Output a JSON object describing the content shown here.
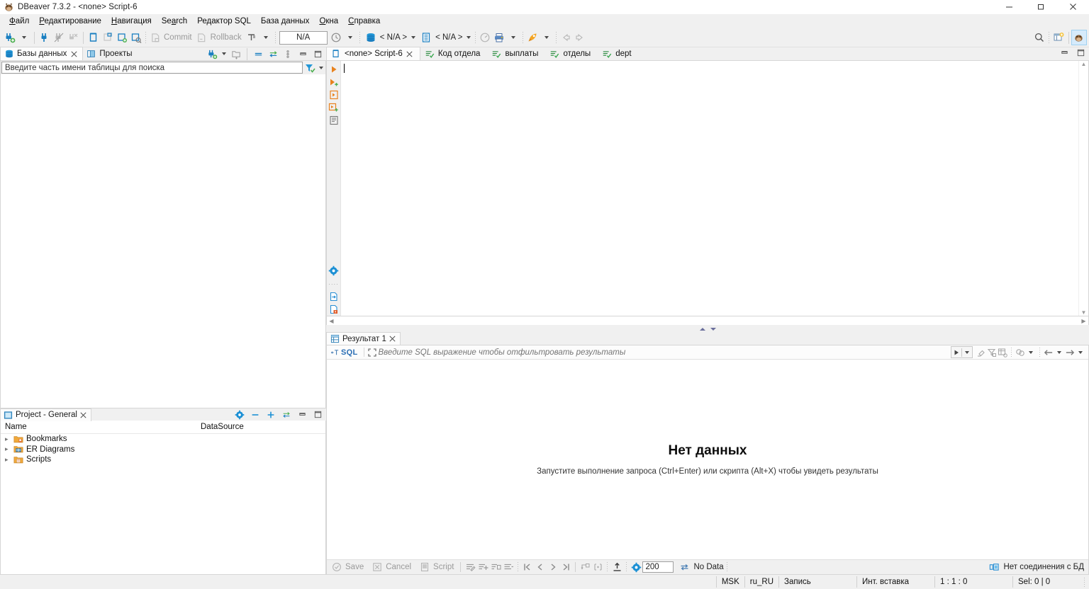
{
  "window": {
    "title": "DBeaver 7.3.2 - <none> Script-6",
    "app_icon": "beaver-icon",
    "minimize": "—",
    "maximize": "❐",
    "close": "✕"
  },
  "menubar": {
    "items": [
      {
        "label": "Файл",
        "mnemonic": "Ф"
      },
      {
        "label": "Редактирование",
        "mnemonic": "Р"
      },
      {
        "label": "Навигация",
        "mnemonic": "Н"
      },
      {
        "label": "Search",
        "mnemonic": "a"
      },
      {
        "label": "Редактор SQL",
        "mnemonic": ""
      },
      {
        "label": "База данных",
        "mnemonic": ""
      },
      {
        "label": "Окна",
        "mnemonic": "О"
      },
      {
        "label": "Справка",
        "mnemonic": "С"
      }
    ]
  },
  "toolbar": {
    "new_connection": "new-connection-icon",
    "connect": "connect-icon",
    "disconnect": "disconnect-icon",
    "invalidate": "invalidate-icon",
    "commit_mode": "transaction-mode-icon",
    "commit_label": "Commit",
    "rollback_label": "Rollback",
    "txn_label": "transaction-log-icon",
    "na_value": "N/A",
    "history_icon": "clock-icon",
    "database_selector": "< N/A >",
    "schema_selector": "< N/A >",
    "dashboard_icon": "dashboard-icon",
    "print_icon": "print-icon",
    "run_icon": "rocket-icon",
    "back_icon": "back-arrow-icon",
    "forward_icon": "forward-arrow-icon",
    "search_icon": "search-icon",
    "new_window_icon": "new-window-icon",
    "perspective_icon": "dbeaver-perspective-icon"
  },
  "navigator": {
    "tabs": [
      {
        "label": "Базы данных",
        "icon": "database-icon",
        "active": true,
        "closable": true
      },
      {
        "label": "Проекты",
        "icon": "projects-icon",
        "active": false,
        "closable": false
      }
    ],
    "tools": [
      "new-connection-icon",
      "chevron-down-icon",
      "new-folder-icon",
      "collapse-all-icon",
      "link-editor-icon",
      "view-menu-icon",
      "minimize-icon",
      "maximize-icon"
    ],
    "search_placeholder": "Введите часть имени таблицы для поиска",
    "search_value": "",
    "filter_icon": "filter-icon",
    "tree_items": []
  },
  "project_panel": {
    "title": "Project - General",
    "icon": "project-icon",
    "tools": [
      "gear-icon",
      "minimize-panel-icon",
      "add-icon",
      "link-editor-icon",
      "minimize-icon",
      "maximize-icon"
    ],
    "columns": [
      "Name",
      "DataSource"
    ],
    "rows": [
      {
        "name": "Bookmarks",
        "icon": "bookmarks-folder-icon",
        "datasource": ""
      },
      {
        "name": "ER Diagrams",
        "icon": "er-diagrams-folder-icon",
        "datasource": ""
      },
      {
        "name": "Scripts",
        "icon": "scripts-folder-icon",
        "datasource": ""
      }
    ]
  },
  "editor": {
    "tabs": [
      {
        "label": "<none> Script-6",
        "icon": "sql-script-icon",
        "active": true,
        "closable": true
      },
      {
        "label": "Код отдела",
        "icon": "sql-result-icon",
        "active": false,
        "closable": false
      },
      {
        "label": "выплаты",
        "icon": "sql-result-icon",
        "active": false,
        "closable": false
      },
      {
        "label": "отделы",
        "icon": "sql-result-icon",
        "active": false,
        "closable": false
      },
      {
        "label": "dept",
        "icon": "sql-result-icon",
        "active": false,
        "closable": false
      }
    ],
    "tools": [
      "minimize-icon",
      "maximize-icon"
    ],
    "gutter_top": [
      "execute-statement-icon",
      "execute-script-icon",
      "execute-in-new-tab-icon",
      "execute-expression-icon",
      "explain-plan-icon"
    ],
    "gutter_bottom": [
      "gear-icon",
      "export-to-file-icon",
      "export-to-db-icon"
    ],
    "content": "",
    "splitter": [
      "collapse-up-icon",
      "collapse-down-icon"
    ]
  },
  "results": {
    "tabs": [
      {
        "label": "Результат 1",
        "icon": "grid-icon",
        "active": true,
        "closable": true
      }
    ],
    "filter": {
      "sql_badge": "SQL",
      "expand_icon": "expand-icon",
      "placeholder": "Введите SQL выражение чтобы отфильтровать результаты",
      "value": "",
      "apply_icon": "play-icon",
      "history_icon": "chevron-down-icon",
      "right_tools": [
        "clear-filter-icon",
        "save-filter-icon",
        "custom-filter-icon",
        "color-settings-icon",
        "prev-query-icon",
        "next-query-icon"
      ]
    },
    "empty_state": {
      "title": "Нет данных",
      "message": "Запустите выполнение запроса (Ctrl+Enter) или скрипта (Alt+X) чтобы увидеть результаты"
    },
    "grid_toolbar": {
      "save_label": "Save",
      "cancel_label": "Cancel",
      "script_label": "Script",
      "edit_icons": [
        "edit-row-icon",
        "add-row-icon",
        "duplicate-row-icon",
        "delete-row-icon"
      ],
      "nav_icons": [
        "first-page-icon",
        "prev-page-icon",
        "next-page-icon",
        "last-page-icon"
      ],
      "misc_icons": [
        "refresh-row-icon",
        "calc-icon"
      ],
      "export_icon": "export-icon",
      "config_icon": "gear-icon",
      "fetch_size": "200",
      "refresh_icon": "refresh-icon",
      "status_label": "No Data",
      "connection_icon": "no-connection-icon",
      "connection_status": "Нет соединения с БД"
    }
  },
  "statusbar": {
    "cells": [
      {
        "label": "MSK",
        "name": "timezone"
      },
      {
        "label": "ru_RU",
        "name": "locale"
      },
      {
        "label": "Запись",
        "name": "edit-mode"
      },
      {
        "label": "Инт. вставка",
        "name": "insert-mode"
      },
      {
        "label": "1 : 1 : 0",
        "name": "cursor-position"
      },
      {
        "label": "Sel: 0 | 0",
        "name": "selection-info"
      }
    ]
  }
}
